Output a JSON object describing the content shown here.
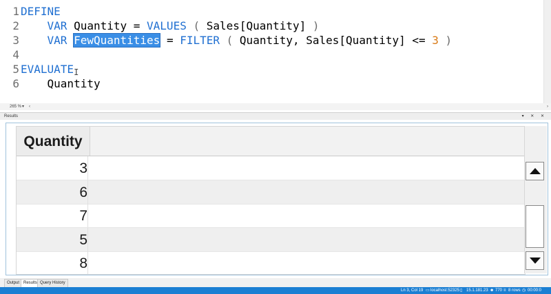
{
  "editor": {
    "zoom": "265 %",
    "lines": [
      {
        "num": "1",
        "tokens": [
          {
            "t": "DEFINE",
            "c": "kw"
          }
        ]
      },
      {
        "num": "2",
        "tokens": [
          {
            "t": "    "
          },
          {
            "t": "VAR",
            "c": "kw"
          },
          {
            "t": " Quantity = "
          },
          {
            "t": "VALUES",
            "c": "kw"
          },
          {
            "t": " ( ",
            "c": "paren"
          },
          {
            "t": "Sales[Quantity]"
          },
          {
            "t": " )",
            "c": "paren"
          }
        ]
      },
      {
        "num": "3",
        "tokens": [
          {
            "t": "    "
          },
          {
            "t": "VAR",
            "c": "kw"
          },
          {
            "t": " "
          },
          {
            "t": "FewQuantities",
            "c": "hl"
          },
          {
            "t": " = "
          },
          {
            "t": "FILTER",
            "c": "kw"
          },
          {
            "t": " ( ",
            "c": "paren"
          },
          {
            "t": "Quantity, Sales[Quantity] <= "
          },
          {
            "t": "3",
            "c": "num"
          },
          {
            "t": " )",
            "c": "paren"
          }
        ]
      },
      {
        "num": "4",
        "tokens": []
      },
      {
        "num": "5",
        "tokens": [
          {
            "t": "EVALUATE",
            "c": "kw"
          }
        ]
      },
      {
        "num": "6",
        "tokens": [
          {
            "t": "    Quantity"
          }
        ]
      }
    ]
  },
  "results_pane": {
    "title": "Results",
    "controls": "▾ ✕ ✕"
  },
  "grid": {
    "column": "Quantity",
    "rows": [
      "3",
      "6",
      "7",
      "5",
      "8"
    ]
  },
  "tabs": [
    "Output",
    "Results",
    "Query History"
  ],
  "active_tab": "Results",
  "status": {
    "position": "Ln 3, Col 19",
    "server": "localhost:52325",
    "version": "15.1.181.23",
    "user": "770",
    "rows": "8 rows",
    "time": "00:00:0"
  },
  "colors": {
    "keyword": "#1f6fd1",
    "number": "#d97a16",
    "selection": "#3a8ee6",
    "statusbar": "#1b7fd3"
  }
}
